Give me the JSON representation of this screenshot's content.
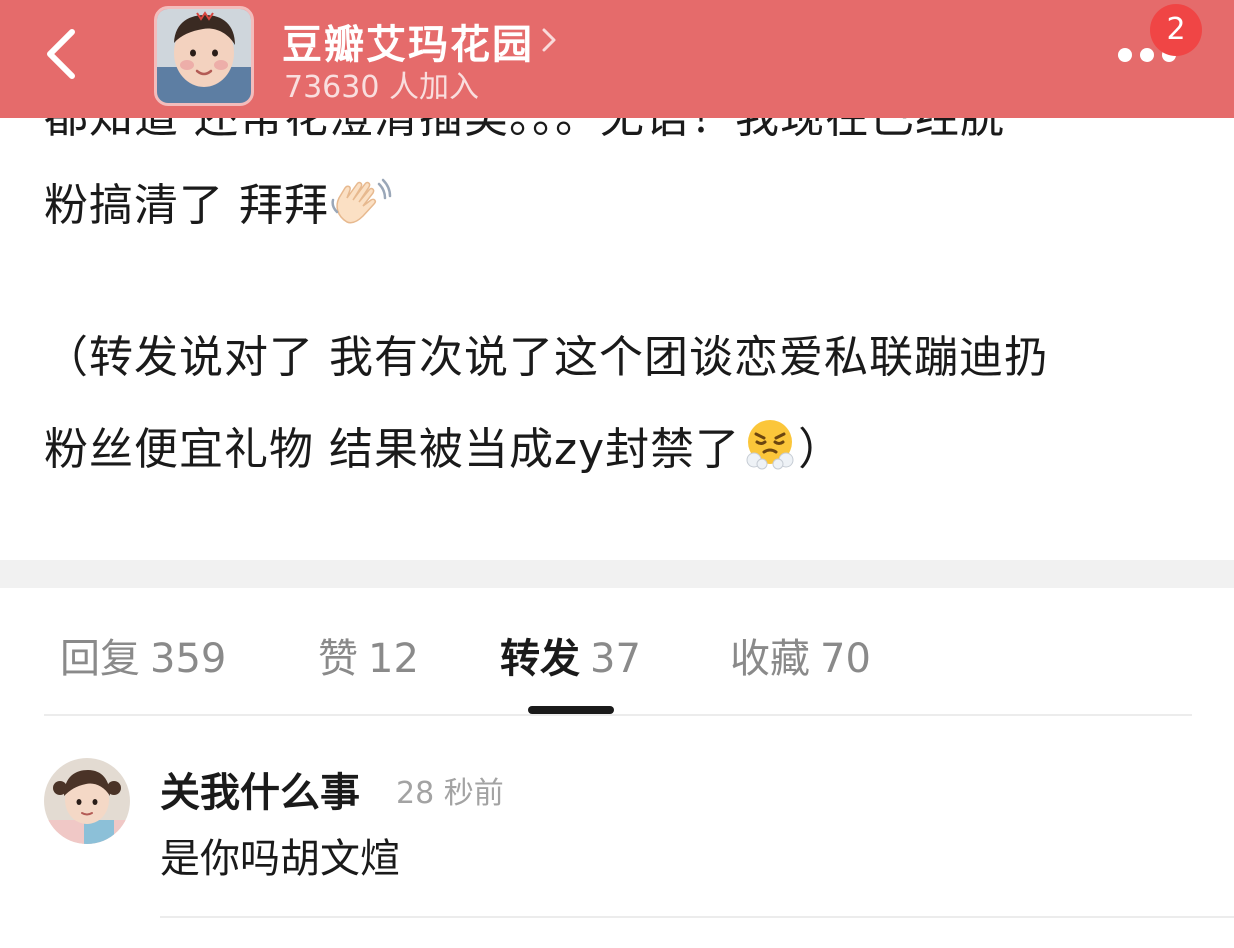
{
  "header": {
    "group_name": "豆瓣艾玛花园",
    "member_count": "73630 人加入",
    "notification_count": "2",
    "background_color": "#e56b6b"
  },
  "post": {
    "line_cut": "都知道 还常花澄清插类。。。无语！我现在已经脱",
    "line_2": "粉搞清了 拜拜",
    "line_2_emoji": "waving-hand-icon",
    "line_3": "（转发说对了 我有次说了这个团谈恋爱私联蹦迪扔",
    "line_4_start": "粉丝便宜礼物 结果被当成zy封禁了",
    "line_4_emoji": "huffing-face-icon",
    "line_4_end": "）"
  },
  "tabs": [
    {
      "label": "回复",
      "count": "359",
      "active": false
    },
    {
      "label": "赞",
      "count": "12",
      "active": false
    },
    {
      "label": "转发",
      "count": "37",
      "active": true
    },
    {
      "label": "收藏",
      "count": "70",
      "active": false
    }
  ],
  "comment": {
    "author": "关我什么事",
    "time": "28 秒前",
    "text": "是你吗胡文煊"
  }
}
